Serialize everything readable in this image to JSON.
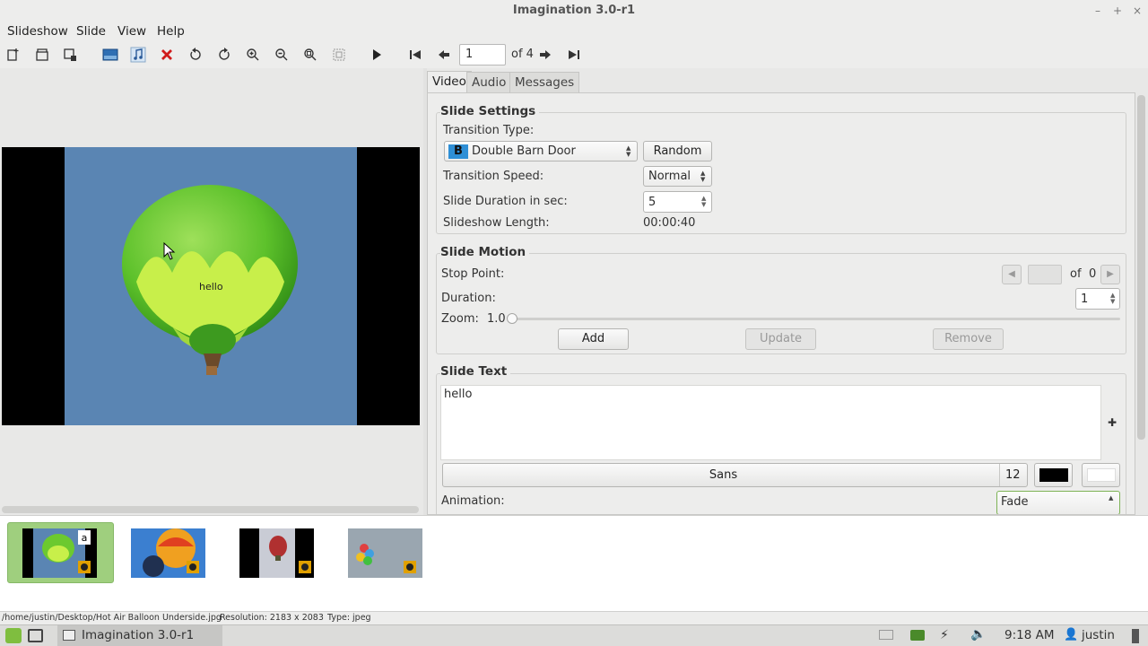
{
  "window": {
    "title": "Imagination 3.0-r1"
  },
  "menu": [
    "Slideshow",
    "Slide",
    "View",
    "Help"
  ],
  "toolbar": {
    "current_slide": "1",
    "of_total": "of 4"
  },
  "preview": {
    "overlay_text": "hello"
  },
  "tabs": [
    "Video",
    "Audio",
    "Messages"
  ],
  "slide_settings": {
    "title": "Slide Settings",
    "transition_type_label": "Transition Type:",
    "transition_type_value": "Double Barn Door",
    "transition_icon_letter": "B",
    "random_button": "Random",
    "transition_speed_label": "Transition Speed:",
    "transition_speed_value": "Normal",
    "duration_label": "Slide Duration in sec:",
    "duration_value": "5",
    "length_label": "Slideshow Length:",
    "length_value": "00:00:40"
  },
  "slide_motion": {
    "title": "Slide Motion",
    "stop_point_label": "Stop Point:",
    "stop_point_of": "of",
    "stop_point_total": "0",
    "duration_label": "Duration:",
    "duration_value": "1",
    "zoom_label": "Zoom:",
    "zoom_value": "1.0",
    "add_button": "Add",
    "update_button": "Update",
    "remove_button": "Remove"
  },
  "slide_text": {
    "title": "Slide Text",
    "text": "hello",
    "font_name": "Sans",
    "font_size": "12",
    "animation_label": "Animation:",
    "animation_value": "Fade",
    "text_color": "#000000",
    "bg_color": "#ffffff"
  },
  "statusbar": {
    "path": "/home/justin/Desktop/Hot Air Balloon Underside.jpg",
    "resolution": "Resolution: 2183 x 2083",
    "type": "Type: jpeg"
  },
  "taskbar": {
    "app": "Imagination 3.0-r1",
    "time": "9:18 AM",
    "user": "justin"
  }
}
